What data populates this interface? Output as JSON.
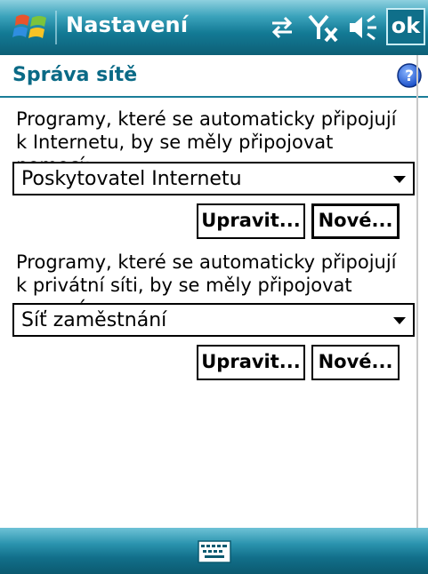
{
  "title_bar": {
    "title": "Nastavení",
    "ok_label": "ok",
    "icons": [
      "windows-start-icon",
      "connectivity-icon",
      "signal-off-icon",
      "volume-icon"
    ]
  },
  "page": {
    "title": "Správa sítě",
    "help_icon": "help-icon"
  },
  "internet_section": {
    "description": "Programy, které se automaticky připojují k Internetu, by se měly připojovat pomocí:",
    "selected": "Poskytovatel Internetu",
    "edit_label": "Upravit...",
    "new_label": "Nové..."
  },
  "private_section": {
    "description": "Programy, které se automaticky připojují k privátní síti, by se měly připojovat pomocí:",
    "selected": "Síť zaměstnání",
    "edit_label": "Upravit...",
    "new_label": "Nové..."
  },
  "bottom_bar": {
    "keyboard_icon": "keyboard-icon"
  },
  "colors": {
    "title_bar": "#137a95",
    "accent_text": "#0a6a86",
    "bottom_bar": "#126f8a"
  }
}
